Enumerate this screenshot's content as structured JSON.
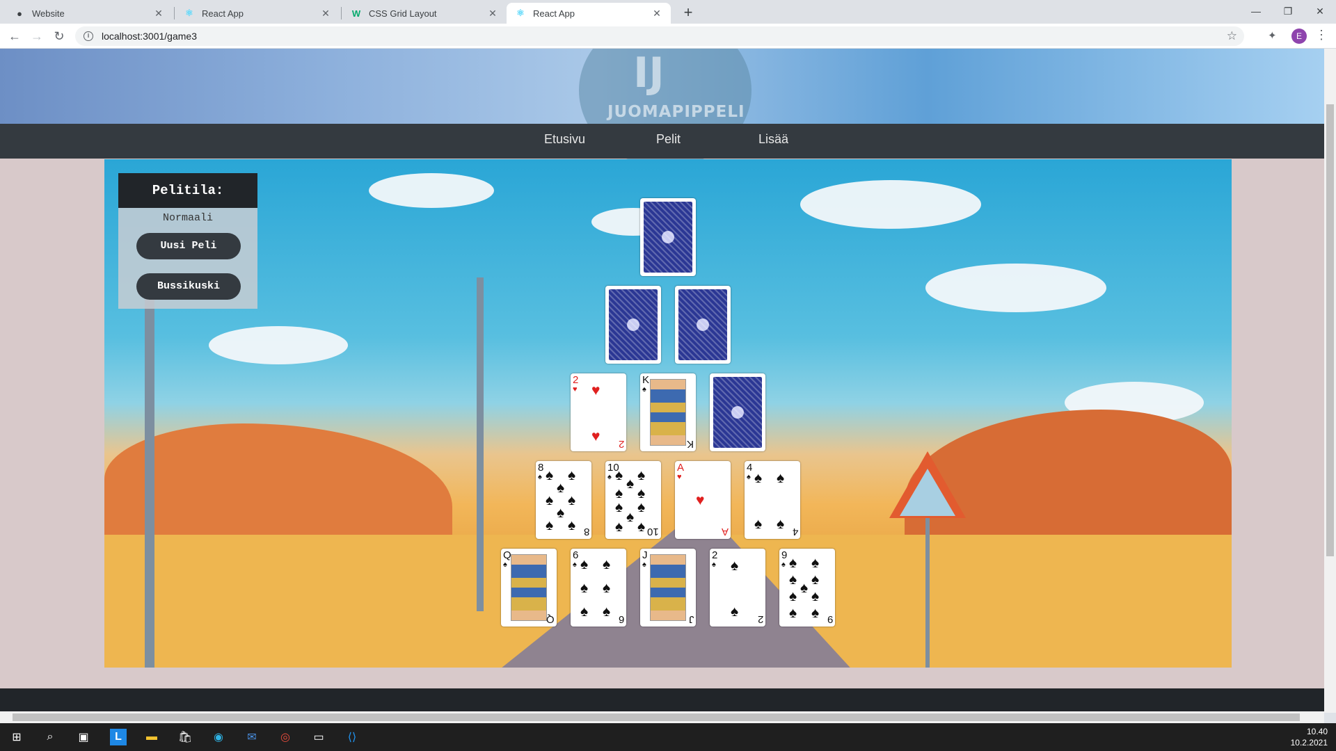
{
  "browser": {
    "tabs": [
      {
        "title": "Website",
        "icon": "github-icon"
      },
      {
        "title": "React App",
        "icon": "react-icon"
      },
      {
        "title": "CSS Grid Layout",
        "icon": "w3schools-icon"
      },
      {
        "title": "React App",
        "icon": "react-icon",
        "active": true
      }
    ],
    "url": "localhost:3001/game3",
    "profile_initial": "E"
  },
  "site": {
    "logo_mark": "IJ",
    "logo_text": "JUOMAPIPPELI",
    "nav": [
      "Etusivu",
      "Pelit",
      "Lisää"
    ]
  },
  "panel": {
    "title": "Pelitila:",
    "mode": "Normaali",
    "new_game": "Uusi Peli",
    "bus_driver": "Bussikuski"
  },
  "pyramid": {
    "row1": [
      {
        "back": true
      }
    ],
    "row2": [
      {
        "back": true
      },
      {
        "back": true
      }
    ],
    "row3": [
      {
        "rank": "2",
        "suit": "♥"
      },
      {
        "rank": "K",
        "suit": "♠",
        "face": true
      },
      {
        "back": true
      }
    ],
    "row4": [
      {
        "rank": "8",
        "suit": "♠"
      },
      {
        "rank": "10",
        "suit": "♠"
      },
      {
        "rank": "A",
        "suit": "♥"
      },
      {
        "rank": "4",
        "suit": "♠"
      }
    ],
    "row5": [
      {
        "rank": "Q",
        "suit": "♠",
        "face": true
      },
      {
        "rank": "6",
        "suit": "♠"
      },
      {
        "rank": "J",
        "suit": "♠",
        "face": true
      },
      {
        "rank": "2",
        "suit": "♠"
      },
      {
        "rank": "9",
        "suit": "♠"
      }
    ]
  },
  "taskbar": {
    "time": "10.40",
    "date": "10.2.2021"
  }
}
